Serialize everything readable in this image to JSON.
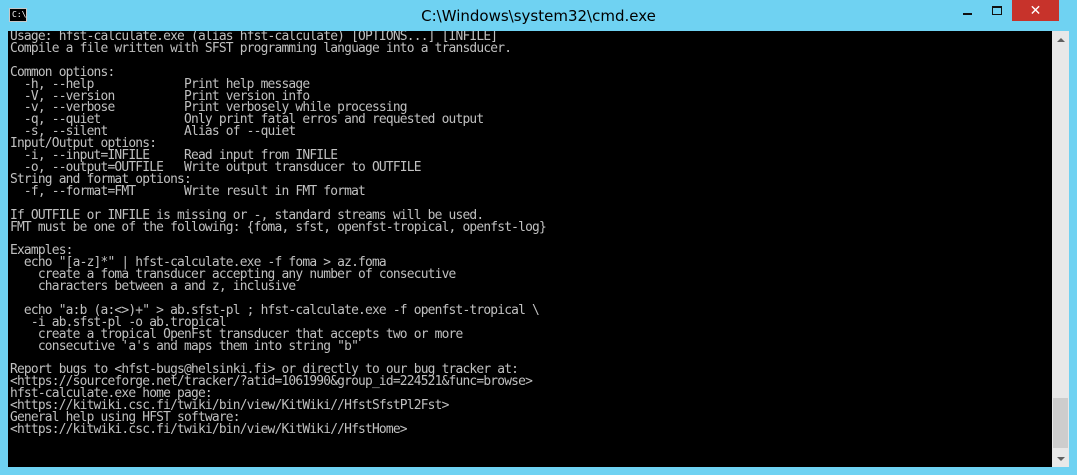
{
  "window": {
    "title": "C:\\Windows\\system32\\cmd.exe",
    "icon_label": "C:\\",
    "icon": "cmd-icon"
  },
  "controls": {
    "minimize_icon": "minimize-icon",
    "maximize_icon": "maximize-icon",
    "close_icon": "close-icon",
    "close_glyph": "✕"
  },
  "console": {
    "lines": [
      "Usage: hfst-calculate.exe (alias hfst-calculate) [OPTIONS...] [INFILE]",
      "Compile a file written with SFST programming language into a transducer.",
      "",
      "Common options:",
      "  -h, --help             Print help message",
      "  -V, --version          Print version info",
      "  -v, --verbose          Print verbosely while processing",
      "  -q, --quiet            Only print fatal erros and requested output",
      "  -s, --silent           Alias of --quiet",
      "Input/Output options:",
      "  -i, --input=INFILE     Read input from INFILE",
      "  -o, --output=OUTFILE   Write output transducer to OUTFILE",
      "String and format options:",
      "  -f, --format=FMT       Write result in FMT format",
      "",
      "If OUTFILE or INFILE is missing or -, standard streams will be used.",
      "FMT must be one of the following: {foma, sfst, openfst-tropical, openfst-log}",
      "",
      "Examples:",
      "  echo \"[a-z]*\" | hfst-calculate.exe -f foma > az.foma",
      "    create a foma transducer accepting any number of consecutive",
      "    characters between a and z, inclusive",
      "",
      "  echo \"a:b (a:<>)+\" > ab.sfst-pl ; hfst-calculate.exe -f openfst-tropical \\",
      "   -i ab.sfst-pl -o ab.tropical",
      "    create a tropical OpenFst transducer that accepts two or more",
      "    consecutive 'a's and maps them into string \"b\"",
      "",
      "Report bugs to <hfst-bugs@helsinki.fi> or directly to our bug tracker at:",
      "<https://sourceforge.net/tracker/?atid=1061990&group_id=224521&func=browse>",
      "hfst-calculate.exe home page:",
      "<https://kitwiki.csc.fi/twiki/bin/view/KitWiki//HfstSfstPl2Fst>",
      "General help using HFST software:",
      "<https://kitwiki.csc.fi/twiki/bin/view/KitWiki//HfstHome>"
    ]
  },
  "colors": {
    "frame": "#6fd2f2",
    "console_bg": "#000000",
    "console_fg": "#c0c0c0",
    "close_button": "#c7332b"
  }
}
